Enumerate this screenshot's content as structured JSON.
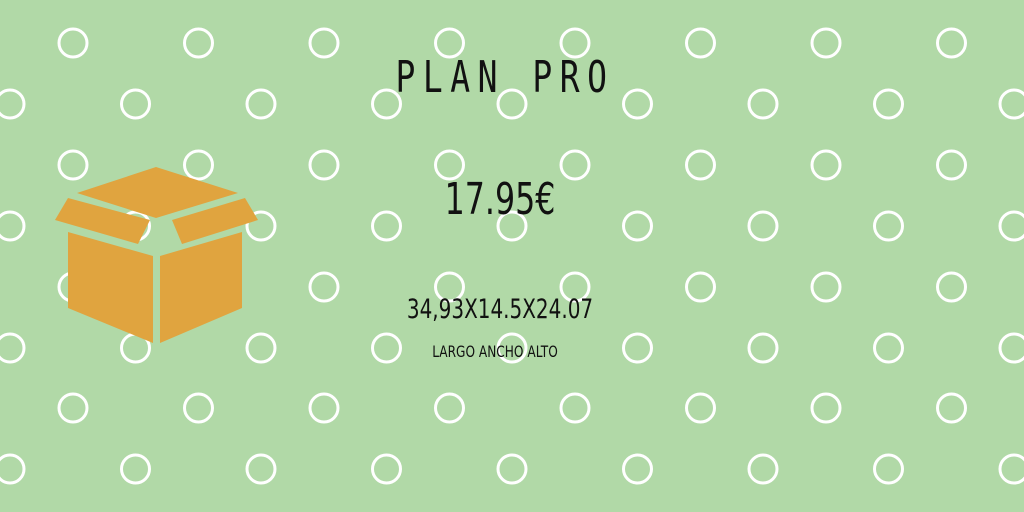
{
  "plan": {
    "title": "PLAN PRO",
    "price": "17.95€",
    "dimensions": "34,93X14.5X24.07",
    "dimensions_label": "LARGO ANCHO ALTO"
  },
  "colors": {
    "background": "#b1d9a7",
    "pattern_circle": "#ffffff",
    "box_fill": "#e0a43f",
    "text": "#111111"
  },
  "icons": {
    "box": "package-box-icon",
    "background_pattern": "circle-pattern"
  }
}
